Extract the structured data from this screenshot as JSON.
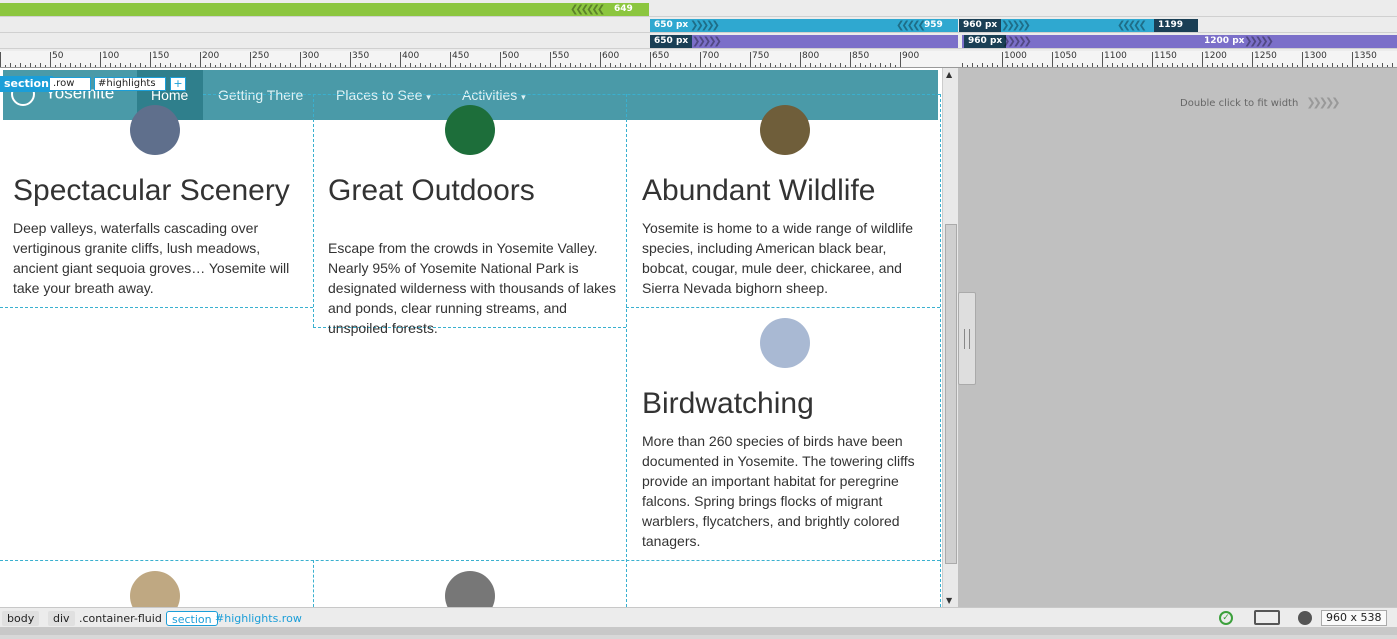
{
  "media_queries": {
    "row1": {
      "label": "649",
      "unit": "px"
    },
    "row2": [
      {
        "label": "650",
        "unit": "px"
      },
      {
        "label": "959",
        "unit": "px"
      },
      {
        "label": "960",
        "unit": "px"
      },
      {
        "label": "1199",
        "unit": "px"
      }
    ],
    "row3": [
      {
        "label": "650",
        "unit": "px"
      },
      {
        "label": "960",
        "unit": "px"
      },
      {
        "label": "1200",
        "unit": "px"
      }
    ]
  },
  "ruler": {
    "labels": [
      "50",
      "100",
      "150",
      "200",
      "250",
      "300",
      "350",
      "400",
      "450",
      "500",
      "550",
      "600",
      "650",
      "700",
      "750",
      "800",
      "850",
      "900",
      "1000",
      "1050",
      "1100",
      "1150",
      "1200",
      "1250",
      "1300",
      "1350"
    ]
  },
  "fit_hint": "Double click to fit width",
  "selector": {
    "tag": "section",
    "class": ".row",
    "id": "#highlights",
    "plus": "+"
  },
  "navbar": {
    "brand": "Yosemite",
    "items": [
      "Home",
      "Getting There",
      "Places to See",
      "Activities"
    ],
    "dropdown_caret": "▾"
  },
  "highlights": [
    {
      "title": "Spectacular Scenery",
      "text": "Deep valleys, waterfalls cascading over vertiginous granite cliffs, lush meadows, ancient giant sequoia groves… Yosemite will take your breath away.",
      "icon": "mountain-icon",
      "color": "#5f6f8c"
    },
    {
      "title": "Great Outdoors",
      "text": "Escape from the crowds in Yosemite Valley. Nearly 95% of Yosemite National Park is designated wilderness with thousands of lakes and ponds, clear running streams, and unspoiled forests.",
      "icon": "leaf-icon",
      "color": "#1d6e3a"
    },
    {
      "title": "Abundant Wildlife",
      "text": "Yosemite is home to a wide range of wildlife species, including American black bear, bobcat, cougar, mule deer, chickaree, and Sierra Nevada bighorn sheep.",
      "icon": "paw-icon",
      "color": "#6f5e3a"
    },
    {
      "title": "Birdwatching",
      "text": "More than 260 species of birds have been documented in Yosemite. The towering cliffs provide an important habitat for peregrine falcons. Spring brings flocks of migrant warblers, flycatchers, and brightly colored tanagers.",
      "icon": "binoculars-icon",
      "color": "#a9b9d3"
    }
  ],
  "lower_icons": [
    {
      "icon": "tent-icon",
      "color": "#bfa882"
    },
    {
      "icon": "car-icon",
      "color": "#777777"
    }
  ],
  "statusbar": {
    "crumbs": [
      "body",
      "div",
      ".container-fluid",
      "section",
      "#highlights.row"
    ],
    "size": "960 x 538"
  }
}
